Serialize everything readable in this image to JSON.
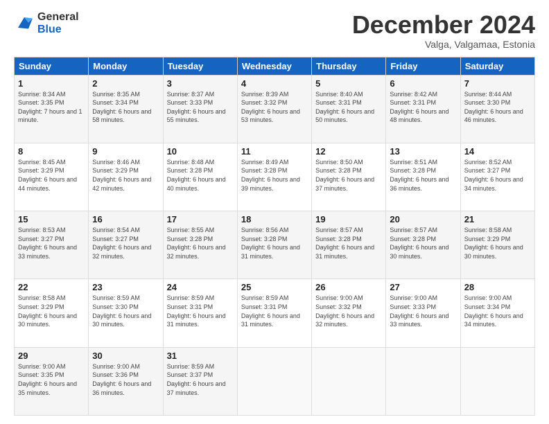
{
  "header": {
    "logo_general": "General",
    "logo_blue": "Blue",
    "month_title": "December 2024",
    "subtitle": "Valga, Valgamaa, Estonia"
  },
  "days_of_week": [
    "Sunday",
    "Monday",
    "Tuesday",
    "Wednesday",
    "Thursday",
    "Friday",
    "Saturday"
  ],
  "weeks": [
    [
      {
        "day": "1",
        "sunrise": "Sunrise: 8:34 AM",
        "sunset": "Sunset: 3:35 PM",
        "daylight": "Daylight: 7 hours and 1 minute."
      },
      {
        "day": "2",
        "sunrise": "Sunrise: 8:35 AM",
        "sunset": "Sunset: 3:34 PM",
        "daylight": "Daylight: 6 hours and 58 minutes."
      },
      {
        "day": "3",
        "sunrise": "Sunrise: 8:37 AM",
        "sunset": "Sunset: 3:33 PM",
        "daylight": "Daylight: 6 hours and 55 minutes."
      },
      {
        "day": "4",
        "sunrise": "Sunrise: 8:39 AM",
        "sunset": "Sunset: 3:32 PM",
        "daylight": "Daylight: 6 hours and 53 minutes."
      },
      {
        "day": "5",
        "sunrise": "Sunrise: 8:40 AM",
        "sunset": "Sunset: 3:31 PM",
        "daylight": "Daylight: 6 hours and 50 minutes."
      },
      {
        "day": "6",
        "sunrise": "Sunrise: 8:42 AM",
        "sunset": "Sunset: 3:31 PM",
        "daylight": "Daylight: 6 hours and 48 minutes."
      },
      {
        "day": "7",
        "sunrise": "Sunrise: 8:44 AM",
        "sunset": "Sunset: 3:30 PM",
        "daylight": "Daylight: 6 hours and 46 minutes."
      }
    ],
    [
      {
        "day": "8",
        "sunrise": "Sunrise: 8:45 AM",
        "sunset": "Sunset: 3:29 PM",
        "daylight": "Daylight: 6 hours and 44 minutes."
      },
      {
        "day": "9",
        "sunrise": "Sunrise: 8:46 AM",
        "sunset": "Sunset: 3:29 PM",
        "daylight": "Daylight: 6 hours and 42 minutes."
      },
      {
        "day": "10",
        "sunrise": "Sunrise: 8:48 AM",
        "sunset": "Sunset: 3:28 PM",
        "daylight": "Daylight: 6 hours and 40 minutes."
      },
      {
        "day": "11",
        "sunrise": "Sunrise: 8:49 AM",
        "sunset": "Sunset: 3:28 PM",
        "daylight": "Daylight: 6 hours and 39 minutes."
      },
      {
        "day": "12",
        "sunrise": "Sunrise: 8:50 AM",
        "sunset": "Sunset: 3:28 PM",
        "daylight": "Daylight: 6 hours and 37 minutes."
      },
      {
        "day": "13",
        "sunrise": "Sunrise: 8:51 AM",
        "sunset": "Sunset: 3:28 PM",
        "daylight": "Daylight: 6 hours and 36 minutes."
      },
      {
        "day": "14",
        "sunrise": "Sunrise: 8:52 AM",
        "sunset": "Sunset: 3:27 PM",
        "daylight": "Daylight: 6 hours and 34 minutes."
      }
    ],
    [
      {
        "day": "15",
        "sunrise": "Sunrise: 8:53 AM",
        "sunset": "Sunset: 3:27 PM",
        "daylight": "Daylight: 6 hours and 33 minutes."
      },
      {
        "day": "16",
        "sunrise": "Sunrise: 8:54 AM",
        "sunset": "Sunset: 3:27 PM",
        "daylight": "Daylight: 6 hours and 32 minutes."
      },
      {
        "day": "17",
        "sunrise": "Sunrise: 8:55 AM",
        "sunset": "Sunset: 3:28 PM",
        "daylight": "Daylight: 6 hours and 32 minutes."
      },
      {
        "day": "18",
        "sunrise": "Sunrise: 8:56 AM",
        "sunset": "Sunset: 3:28 PM",
        "daylight": "Daylight: 6 hours and 31 minutes."
      },
      {
        "day": "19",
        "sunrise": "Sunrise: 8:57 AM",
        "sunset": "Sunset: 3:28 PM",
        "daylight": "Daylight: 6 hours and 31 minutes."
      },
      {
        "day": "20",
        "sunrise": "Sunrise: 8:57 AM",
        "sunset": "Sunset: 3:28 PM",
        "daylight": "Daylight: 6 hours and 30 minutes."
      },
      {
        "day": "21",
        "sunrise": "Sunrise: 8:58 AM",
        "sunset": "Sunset: 3:29 PM",
        "daylight": "Daylight: 6 hours and 30 minutes."
      }
    ],
    [
      {
        "day": "22",
        "sunrise": "Sunrise: 8:58 AM",
        "sunset": "Sunset: 3:29 PM",
        "daylight": "Daylight: 6 hours and 30 minutes."
      },
      {
        "day": "23",
        "sunrise": "Sunrise: 8:59 AM",
        "sunset": "Sunset: 3:30 PM",
        "daylight": "Daylight: 6 hours and 30 minutes."
      },
      {
        "day": "24",
        "sunrise": "Sunrise: 8:59 AM",
        "sunset": "Sunset: 3:31 PM",
        "daylight": "Daylight: 6 hours and 31 minutes."
      },
      {
        "day": "25",
        "sunrise": "Sunrise: 8:59 AM",
        "sunset": "Sunset: 3:31 PM",
        "daylight": "Daylight: 6 hours and 31 minutes."
      },
      {
        "day": "26",
        "sunrise": "Sunrise: 9:00 AM",
        "sunset": "Sunset: 3:32 PM",
        "daylight": "Daylight: 6 hours and 32 minutes."
      },
      {
        "day": "27",
        "sunrise": "Sunrise: 9:00 AM",
        "sunset": "Sunset: 3:33 PM",
        "daylight": "Daylight: 6 hours and 33 minutes."
      },
      {
        "day": "28",
        "sunrise": "Sunrise: 9:00 AM",
        "sunset": "Sunset: 3:34 PM",
        "daylight": "Daylight: 6 hours and 34 minutes."
      }
    ],
    [
      {
        "day": "29",
        "sunrise": "Sunrise: 9:00 AM",
        "sunset": "Sunset: 3:35 PM",
        "daylight": "Daylight: 6 hours and 35 minutes."
      },
      {
        "day": "30",
        "sunrise": "Sunrise: 9:00 AM",
        "sunset": "Sunset: 3:36 PM",
        "daylight": "Daylight: 6 hours and 36 minutes."
      },
      {
        "day": "31",
        "sunrise": "Sunrise: 8:59 AM",
        "sunset": "Sunset: 3:37 PM",
        "daylight": "Daylight: 6 hours and 37 minutes."
      },
      null,
      null,
      null,
      null
    ]
  ]
}
